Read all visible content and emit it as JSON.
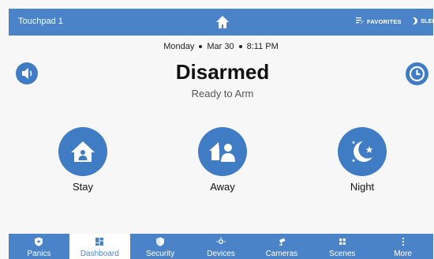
{
  "topbar": {
    "title": "Touchpad 1",
    "favorites_label": "FAVORITES",
    "sleep_label": "SLEEP"
  },
  "datetime": {
    "day": "Monday",
    "date": "Mar 30",
    "time": "8:11 PM"
  },
  "status": {
    "title": "Disarmed",
    "subtitle": "Ready to Arm"
  },
  "arm_modes": [
    {
      "label": "Stay",
      "icon": "stay-home-icon"
    },
    {
      "label": "Away",
      "icon": "away-people-icon"
    },
    {
      "label": "Night",
      "icon": "night-moon-icon"
    }
  ],
  "nav": [
    {
      "label": "Panics",
      "icon": "shield-star-icon",
      "active": false
    },
    {
      "label": "Dashboard",
      "icon": "grid-icon",
      "active": true
    },
    {
      "label": "Security",
      "icon": "shield-icon",
      "active": false
    },
    {
      "label": "Devices",
      "icon": "device-hub-icon",
      "active": false
    },
    {
      "label": "Cameras",
      "icon": "camera-icon",
      "active": false
    },
    {
      "label": "Scenes",
      "icon": "scenes-icon",
      "active": false
    },
    {
      "label": "More",
      "icon": "more-vertical-icon",
      "active": false
    }
  ],
  "colors": {
    "accent": "#4a83c8",
    "button": "#3f7cc4",
    "background": "#f7f7f7"
  }
}
